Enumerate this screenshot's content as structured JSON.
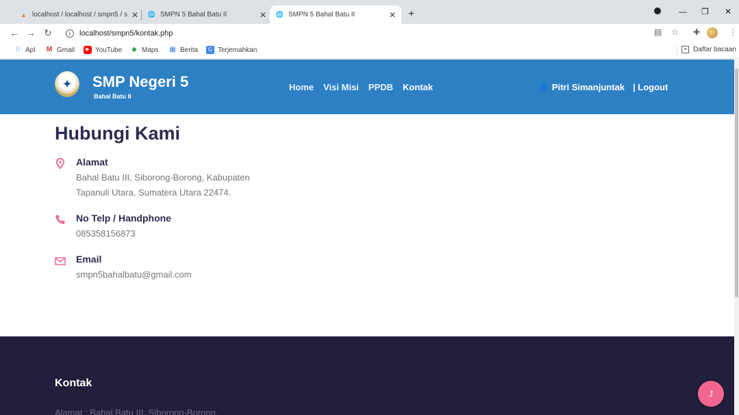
{
  "browser": {
    "tabs": [
      {
        "title": "localhost / localhost / smpn5 / s",
        "active": false
      },
      {
        "title": "SMPN 5 Bahal Batu II",
        "active": false
      },
      {
        "title": "SMPN 5 Bahal Batu II",
        "active": true
      }
    ],
    "new_tab": "+",
    "url": "localhost/smpn5/kontak.php",
    "bookmarks": [
      {
        "label": "Apl",
        "icon": "apps-grid-icon"
      },
      {
        "label": "Gmail",
        "icon": "gmail-icon"
      },
      {
        "label": "YouTube",
        "icon": "youtube-icon"
      },
      {
        "label": "Maps",
        "icon": "maps-icon"
      },
      {
        "label": "Berita",
        "icon": "news-icon"
      },
      {
        "label": "Terjemahkan",
        "icon": "translate-icon"
      }
    ],
    "reading_list": "Daftar bacaan"
  },
  "header": {
    "brand_title": "SMP Negeri 5",
    "brand_sub": "Bahal Batu II",
    "nav": [
      "Home",
      "Visi Misi",
      "PPDB",
      "Kontak"
    ],
    "active_nav": "Kontak",
    "user_name": "Pitri Simanjuntak",
    "logout": "| Logout"
  },
  "contact": {
    "title": "Hubungi Kami",
    "items": [
      {
        "label": "Alamat",
        "text": "Bahal Batu III, Siborong-Borong, Kabupaten Tapanuli Utara, Sumatera Utara 22474.",
        "icon": "map-marker-icon"
      },
      {
        "label": "No Telp / Handphone",
        "text": "085358156873",
        "icon": "phone-icon"
      },
      {
        "label": "Email",
        "text": "smpn5bahalbatu@gmail.com",
        "icon": "envelope-icon"
      }
    ]
  },
  "footer": {
    "title": "Kontak",
    "text": "Alamat : Bahal Batu III, Siborong-Borong,"
  },
  "colors": {
    "header_bg": "#2e80c4",
    "footer_bg": "#221f3c",
    "accent": "#ef6c95",
    "heading": "#2c2a50"
  }
}
